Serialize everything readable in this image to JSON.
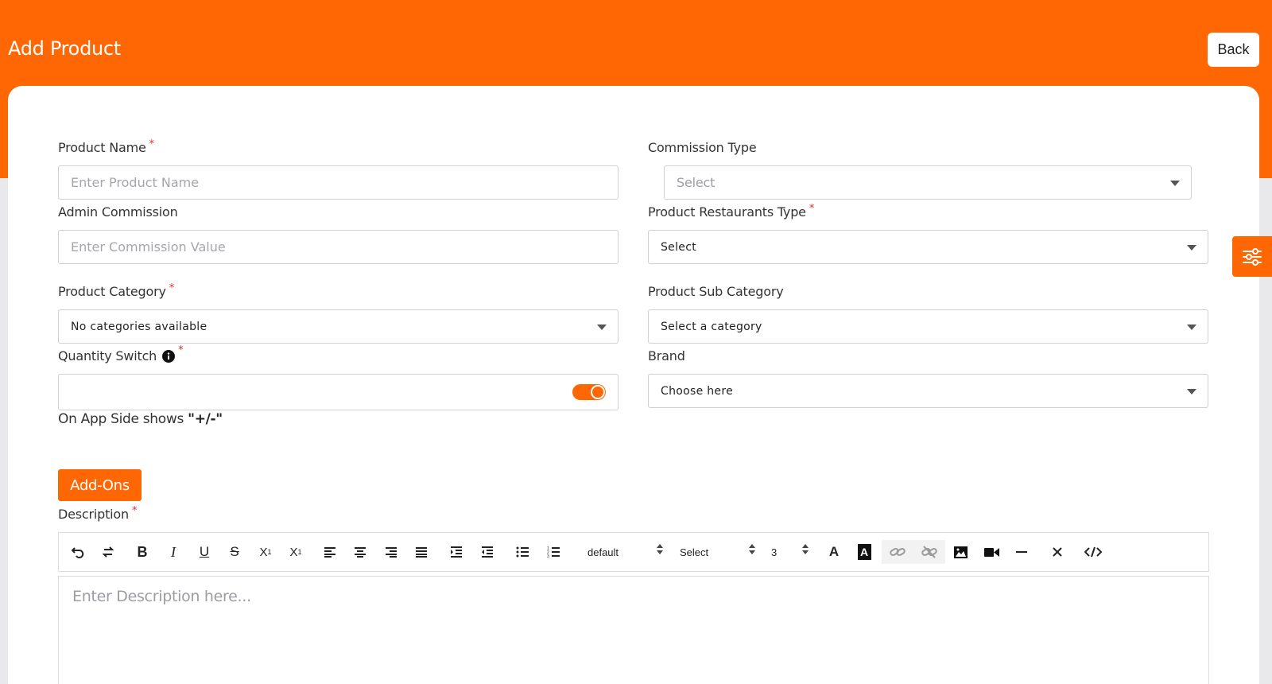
{
  "header": {
    "title": "Add Product",
    "back_label": "Back"
  },
  "form": {
    "product_name": {
      "label": "Product Name",
      "required": "*",
      "placeholder": "Enter Product Name"
    },
    "commission_type": {
      "label": "Commission Type",
      "selected": "Select"
    },
    "admin_commission": {
      "label": "Admin Commission",
      "placeholder": "Enter Commission Value"
    },
    "restaurants_type": {
      "label": "Product Restaurants Type",
      "required": "*",
      "selected": "Select"
    },
    "category": {
      "label": "Product Category",
      "required": "*",
      "selected": "No categories available"
    },
    "sub_category": {
      "label": "Product Sub Category",
      "selected": "Select a category"
    },
    "quantity_switch": {
      "label": "Quantity Switch",
      "required": "*",
      "info_icon": "info-icon",
      "enabled": true,
      "hint_prefix": "On App Side shows ",
      "hint_value": "\"+/-\""
    },
    "brand": {
      "label": "Brand",
      "selected": "Choose here"
    },
    "addons_label": "Add-Ons",
    "description": {
      "label": "Description",
      "required": "*",
      "placeholder": "Enter Description here..."
    }
  },
  "editor_toolbar": {
    "font_family": "default",
    "block_format": "Select",
    "font_size": "3",
    "icons": [
      "undo-icon",
      "redo-icon",
      "bold-icon",
      "italic-icon",
      "underline-icon",
      "strikethrough-icon",
      "subscript-icon",
      "superscript-icon",
      "align-left-icon",
      "align-center-icon",
      "align-right-icon",
      "align-justify-icon",
      "indent-icon",
      "outdent-icon",
      "bullet-list-icon",
      "numbered-list-icon",
      "font-color-icon",
      "highlight-color-icon",
      "link-icon",
      "unlink-icon",
      "image-icon",
      "video-icon",
      "horizontal-rule-icon",
      "clear-format-icon",
      "code-view-icon"
    ]
  },
  "side_tab": {
    "icon": "settings-sliders-icon"
  },
  "colors": {
    "brand": "#ff6604",
    "required": "#e52b2b"
  }
}
